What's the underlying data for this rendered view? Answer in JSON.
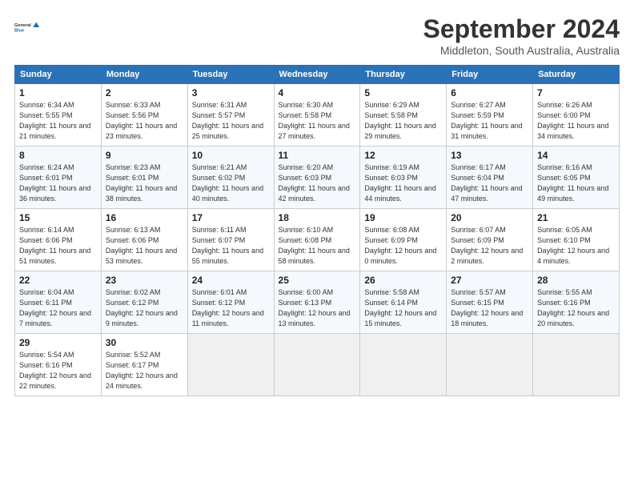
{
  "logo": {
    "line1": "General",
    "line2": "Blue"
  },
  "title": "September 2024",
  "subtitle": "Middleton, South Australia, Australia",
  "headers": [
    "Sunday",
    "Monday",
    "Tuesday",
    "Wednesday",
    "Thursday",
    "Friday",
    "Saturday"
  ],
  "weeks": [
    [
      {
        "day": "1",
        "sunrise": "Sunrise: 6:34 AM",
        "sunset": "Sunset: 5:55 PM",
        "daylight": "Daylight: 11 hours and 21 minutes."
      },
      {
        "day": "2",
        "sunrise": "Sunrise: 6:33 AM",
        "sunset": "Sunset: 5:56 PM",
        "daylight": "Daylight: 11 hours and 23 minutes."
      },
      {
        "day": "3",
        "sunrise": "Sunrise: 6:31 AM",
        "sunset": "Sunset: 5:57 PM",
        "daylight": "Daylight: 11 hours and 25 minutes."
      },
      {
        "day": "4",
        "sunrise": "Sunrise: 6:30 AM",
        "sunset": "Sunset: 5:58 PM",
        "daylight": "Daylight: 11 hours and 27 minutes."
      },
      {
        "day": "5",
        "sunrise": "Sunrise: 6:29 AM",
        "sunset": "Sunset: 5:58 PM",
        "daylight": "Daylight: 11 hours and 29 minutes."
      },
      {
        "day": "6",
        "sunrise": "Sunrise: 6:27 AM",
        "sunset": "Sunset: 5:59 PM",
        "daylight": "Daylight: 11 hours and 31 minutes."
      },
      {
        "day": "7",
        "sunrise": "Sunrise: 6:26 AM",
        "sunset": "Sunset: 6:00 PM",
        "daylight": "Daylight: 11 hours and 34 minutes."
      }
    ],
    [
      {
        "day": "8",
        "sunrise": "Sunrise: 6:24 AM",
        "sunset": "Sunset: 6:01 PM",
        "daylight": "Daylight: 11 hours and 36 minutes."
      },
      {
        "day": "9",
        "sunrise": "Sunrise: 6:23 AM",
        "sunset": "Sunset: 6:01 PM",
        "daylight": "Daylight: 11 hours and 38 minutes."
      },
      {
        "day": "10",
        "sunrise": "Sunrise: 6:21 AM",
        "sunset": "Sunset: 6:02 PM",
        "daylight": "Daylight: 11 hours and 40 minutes."
      },
      {
        "day": "11",
        "sunrise": "Sunrise: 6:20 AM",
        "sunset": "Sunset: 6:03 PM",
        "daylight": "Daylight: 11 hours and 42 minutes."
      },
      {
        "day": "12",
        "sunrise": "Sunrise: 6:19 AM",
        "sunset": "Sunset: 6:03 PM",
        "daylight": "Daylight: 11 hours and 44 minutes."
      },
      {
        "day": "13",
        "sunrise": "Sunrise: 6:17 AM",
        "sunset": "Sunset: 6:04 PM",
        "daylight": "Daylight: 11 hours and 47 minutes."
      },
      {
        "day": "14",
        "sunrise": "Sunrise: 6:16 AM",
        "sunset": "Sunset: 6:05 PM",
        "daylight": "Daylight: 11 hours and 49 minutes."
      }
    ],
    [
      {
        "day": "15",
        "sunrise": "Sunrise: 6:14 AM",
        "sunset": "Sunset: 6:06 PM",
        "daylight": "Daylight: 11 hours and 51 minutes."
      },
      {
        "day": "16",
        "sunrise": "Sunrise: 6:13 AM",
        "sunset": "Sunset: 6:06 PM",
        "daylight": "Daylight: 11 hours and 53 minutes."
      },
      {
        "day": "17",
        "sunrise": "Sunrise: 6:11 AM",
        "sunset": "Sunset: 6:07 PM",
        "daylight": "Daylight: 11 hours and 55 minutes."
      },
      {
        "day": "18",
        "sunrise": "Sunrise: 6:10 AM",
        "sunset": "Sunset: 6:08 PM",
        "daylight": "Daylight: 11 hours and 58 minutes."
      },
      {
        "day": "19",
        "sunrise": "Sunrise: 6:08 AM",
        "sunset": "Sunset: 6:09 PM",
        "daylight": "Daylight: 12 hours and 0 minutes."
      },
      {
        "day": "20",
        "sunrise": "Sunrise: 6:07 AM",
        "sunset": "Sunset: 6:09 PM",
        "daylight": "Daylight: 12 hours and 2 minutes."
      },
      {
        "day": "21",
        "sunrise": "Sunrise: 6:05 AM",
        "sunset": "Sunset: 6:10 PM",
        "daylight": "Daylight: 12 hours and 4 minutes."
      }
    ],
    [
      {
        "day": "22",
        "sunrise": "Sunrise: 6:04 AM",
        "sunset": "Sunset: 6:11 PM",
        "daylight": "Daylight: 12 hours and 7 minutes."
      },
      {
        "day": "23",
        "sunrise": "Sunrise: 6:02 AM",
        "sunset": "Sunset: 6:12 PM",
        "daylight": "Daylight: 12 hours and 9 minutes."
      },
      {
        "day": "24",
        "sunrise": "Sunrise: 6:01 AM",
        "sunset": "Sunset: 6:12 PM",
        "daylight": "Daylight: 12 hours and 11 minutes."
      },
      {
        "day": "25",
        "sunrise": "Sunrise: 6:00 AM",
        "sunset": "Sunset: 6:13 PM",
        "daylight": "Daylight: 12 hours and 13 minutes."
      },
      {
        "day": "26",
        "sunrise": "Sunrise: 5:58 AM",
        "sunset": "Sunset: 6:14 PM",
        "daylight": "Daylight: 12 hours and 15 minutes."
      },
      {
        "day": "27",
        "sunrise": "Sunrise: 5:57 AM",
        "sunset": "Sunset: 6:15 PM",
        "daylight": "Daylight: 12 hours and 18 minutes."
      },
      {
        "day": "28",
        "sunrise": "Sunrise: 5:55 AM",
        "sunset": "Sunset: 6:16 PM",
        "daylight": "Daylight: 12 hours and 20 minutes."
      }
    ],
    [
      {
        "day": "29",
        "sunrise": "Sunrise: 5:54 AM",
        "sunset": "Sunset: 6:16 PM",
        "daylight": "Daylight: 12 hours and 22 minutes."
      },
      {
        "day": "30",
        "sunrise": "Sunrise: 5:52 AM",
        "sunset": "Sunset: 6:17 PM",
        "daylight": "Daylight: 12 hours and 24 minutes."
      },
      null,
      null,
      null,
      null,
      null
    ]
  ]
}
